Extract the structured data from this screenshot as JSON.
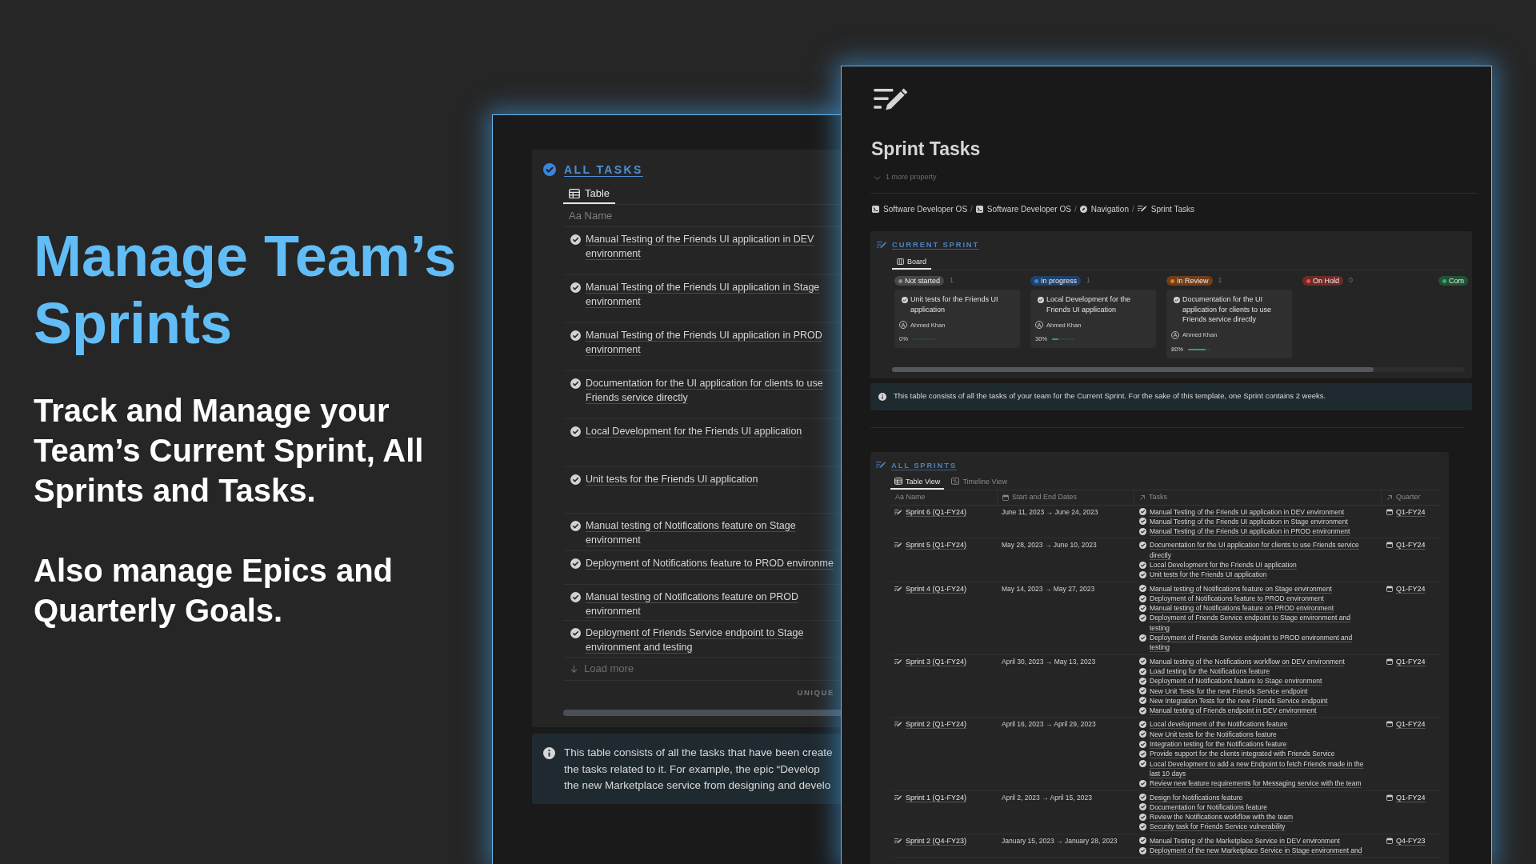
{
  "hero": {
    "title": "Manage Team’s Sprints",
    "paragraphs": [
      "Track and Manage your Team’s Current Sprint, All Sprints and Tasks.",
      "Also manage Epics and Quarterly Goals."
    ]
  },
  "all_tasks_window": {
    "heading": "ALL TASKS",
    "tabs": [
      {
        "label": "Table",
        "selected": true
      }
    ],
    "column": "Aa Name",
    "rows": [
      "Manual Testing of the Friends UI application in DEV environment",
      "Manual Testing of the Friends UI application in Stage environment",
      "Manual Testing of the Friends UI application in PROD environment",
      "Documentation for the UI application for clients to use Friends service directly",
      "Local Development for the Friends UI application",
      "Unit tests for the Friends UI application",
      "Manual testing of Notifications feature on Stage environment",
      "Deployment of Notifications feature to PROD environme",
      "Manual testing of Notifications feature on PROD environment",
      "Deployment of Friends Service endpoint to Stage environment and testing"
    ],
    "load_more": "Load more",
    "footer": "UNIQUE",
    "callout_lines": [
      "This table consists of all the tasks that have been create",
      "the tasks related to it. For example, the epic “Develop",
      "the new Marketplace service from designing and develo"
    ]
  },
  "sprint_tasks_window": {
    "title": "Sprint Tasks",
    "more_property": "1 more property",
    "breadcrumb": [
      {
        "label": "Software Developer OS",
        "kind": "workspace",
        "separator": "/"
      },
      {
        "label": "Software Developer OS",
        "kind": "workspace",
        "separator": "/"
      },
      {
        "label": "Navigation",
        "kind": "navigation",
        "separator": "/"
      },
      {
        "label": "Sprint Tasks",
        "kind": "database"
      }
    ],
    "current_sprint": {
      "heading": "CURRENT SPRINT",
      "tabs": [
        {
          "label": "Board",
          "selected": true
        }
      ],
      "columns": [
        {
          "status": "Not started",
          "color": "#8e8e8e",
          "count": "1",
          "cards": [
            {
              "title": "Unit tests for the Friends UI application",
              "initial": "A",
              "assignee": "Ahmed Khan",
              "progress": "0%",
              "level": 0
            }
          ]
        },
        {
          "status": "In progress",
          "color": "#3d84d8",
          "count": "1",
          "cards": [
            {
              "title": "Local Development for the Friends UI application",
              "initial": "A",
              "assignee": "Ahmed Khan",
              "progress": "30%",
              "level": 0.3
            }
          ]
        },
        {
          "status": "In Review",
          "color": "#e07b30",
          "count": "1",
          "cards": [
            {
              "title": "Documentation for the UI application for clients to use Friends service directly",
              "initial": "A",
              "assignee": "Ahmed Khan",
              "progress": "80%",
              "level": 0.8
            }
          ]
        },
        {
          "status": "On Hold",
          "color": "#e0534c",
          "count": "0"
        },
        {
          "status": "Com",
          "color": "#3fa66b"
        }
      ],
      "callout": "This table consists of all the tasks of your team for the Current Sprint. For the sake of this template, one Sprint contains 2 weeks."
    },
    "all_sprints": {
      "heading": "ALL SPRINTS",
      "tabs": [
        {
          "label": "Table View",
          "kind": "table",
          "selected": true
        },
        {
          "label": "Timeline View",
          "kind": "timeline",
          "selected": false
        }
      ],
      "columns": [
        {
          "label": "Aa Name",
          "kind": "title"
        },
        {
          "label": "Start and End Dates",
          "kind": "date"
        },
        {
          "label": "Tasks",
          "kind": "relation"
        },
        {
          "label": "Quarter",
          "kind": "relation"
        }
      ],
      "rows": [
        {
          "name": "Sprint 6 (Q1-FY24)",
          "dates": "June 11, 2023 → June 24, 2023",
          "tasks": [
            "Manual Testing of the Friends UI application in DEV environment",
            "Manual Testing of the Friends UI application in Stage environment",
            "Manual Testing of the Friends UI application in PROD environment"
          ],
          "quarter": "Q1-FY24"
        },
        {
          "name": "Sprint 5 (Q1-FY24)",
          "dates": "May 28, 2023 → June 10, 2023",
          "tasks": [
            "Documentation for the UI application for clients to use Friends service directly",
            "Local Development for the Friends UI application",
            "Unit tests for the Friends UI application"
          ],
          "quarter": "Q1-FY24"
        },
        {
          "name": "Sprint 4 (Q1-FY24)",
          "dates": "May 14, 2023 → May 27, 2023",
          "tasks": [
            "Manual testing of Notifications feature on Stage environment",
            "Deployment of Notifications feature to PROD environment",
            "Manual testing of Notifications feature on PROD environment",
            "Deployment of Friends Service endpoint to Stage environment and testing",
            "Deployment of Friends Service endpoint to PROD environment and testing"
          ],
          "quarter": "Q1-FY24"
        },
        {
          "name": "Sprint 3 (Q1-FY24)",
          "dates": "April 30, 2023 → May 13, 2023",
          "tasks": [
            "Manual testing of the Notifications workflow on DEV environment",
            "Load testing for the Notifications feature",
            "Deployment of Notifications feature to Stage environment",
            "New Unit Tests for the new Friends Service endpoint",
            "New Integration Tests for the new Friends Service endpoint",
            "Manual testing of Friends endpoint in DEV environment"
          ],
          "quarter": "Q1-FY24"
        },
        {
          "name": "Sprint 2 (Q1-FY24)",
          "dates": "April 16, 2023 → April 29, 2023",
          "tasks": [
            "Local development of the Notifications feature",
            "New Unit tests for the Notifications feature",
            "Integration testing for the Notifications feature",
            "Provide support for the clients integrated with Friends Service",
            "Local Development to add a new Endpoint to fetch Friends made in the last 10 days",
            "Review new feature requirements for Messaging service with the team"
          ],
          "quarter": "Q1-FY24"
        },
        {
          "name": "Sprint 1 (Q1-FY24)",
          "dates": "April 2, 2023 → April 15, 2023",
          "tasks": [
            "Design for Notifications feature",
            "Documentation for Notifications feature",
            "Review the Notifications workflow with the team",
            "Security task for Friends Service vulnerability"
          ],
          "quarter": "Q1-FY24"
        },
        {
          "name": "Sprint 2 (Q4-FY23)",
          "dates": "January 15, 2023 → January 28, 2023",
          "tasks": [
            "Manual Testing of the Marketplace Service in DEV environment",
            "Deployment of the new Marketplace Service in Stage environment and"
          ],
          "quarter": "Q4-FY23"
        }
      ]
    }
  }
}
